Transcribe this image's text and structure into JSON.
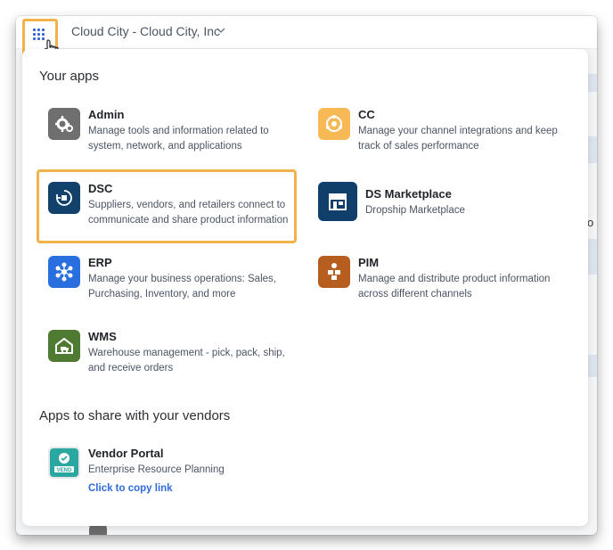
{
  "header": {
    "org_name": "Cloud City - Cloud City, Inc"
  },
  "panel": {
    "your_apps_title": "Your apps",
    "share_title": "Apps to share with your vendors",
    "apps": [
      {
        "name": "Admin",
        "description": "Manage tools and information related to system, network, and applications",
        "icon": "gear-icon",
        "color": "#6f6f6f"
      },
      {
        "name": "CC",
        "description": "Manage your channel integrations and keep track of sales performance",
        "icon": "channel-icon",
        "color": "#f7b955"
      },
      {
        "name": "DSC",
        "description": "Suppliers, vendors, and retailers connect to communicate and share product information",
        "icon": "box-cycle-icon",
        "color": "#12426b"
      },
      {
        "name": "DS Marketplace",
        "description": "Dropship Marketplace",
        "icon": "store-icon",
        "color": "#0f3f6a"
      },
      {
        "name": "ERP",
        "description": "Manage your business operations: Sales, Purchasing, Inventory, and more",
        "icon": "erp-network-icon",
        "color": "#2a6fe0"
      },
      {
        "name": "PIM",
        "description": "Manage and distribute product information across different channels",
        "icon": "pim-boxes-icon",
        "color": "#b65e1f"
      },
      {
        "name": "WMS",
        "description": "Warehouse management - pick, pack, ship, and receive orders",
        "icon": "warehouse-truck-icon",
        "color": "#4f7a31"
      }
    ],
    "vendor_apps": [
      {
        "name": "Vendor Portal",
        "description": "Enterprise Resource Planning",
        "link": "Click to copy link",
        "icon": "vend-icon",
        "color": "#2aa7a0"
      }
    ]
  },
  "background": {
    "partial_char": "o"
  },
  "colors": {
    "highlight": "#f0b24a",
    "link": "#2e6bd8"
  }
}
